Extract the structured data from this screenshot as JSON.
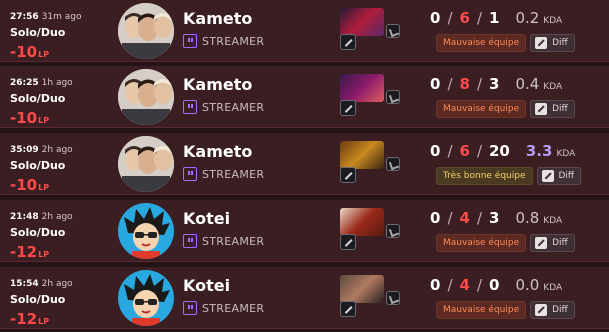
{
  "matches": [
    {
      "time": "27:56",
      "ago": "31m ago",
      "queue": "Solo/Duo",
      "lp": "-10",
      "lp_unit": "LP",
      "player": "Kameto",
      "streamer_label": "STREAMER",
      "avatar": "person",
      "kda": {
        "k": "0",
        "d": "6",
        "a": "1",
        "ratio": "0.2",
        "label": "KDA"
      },
      "tag": {
        "label": "Mauvaise équipe",
        "type": "bad"
      },
      "diff_label": "Diff",
      "champ_colors": [
        "#2a1a3a",
        "#b01c3c",
        "#5a2a6a"
      ]
    },
    {
      "time": "26:25",
      "ago": "1h ago",
      "queue": "Solo/Duo",
      "lp": "-10",
      "lp_unit": "LP",
      "player": "Kameto",
      "streamer_label": "STREAMER",
      "avatar": "person",
      "kda": {
        "k": "0",
        "d": "8",
        "a": "3",
        "ratio": "0.4",
        "label": "KDA"
      },
      "tag": {
        "label": "Mauvaise équipe",
        "type": "bad"
      },
      "diff_label": "Diff",
      "champ_colors": [
        "#3a1a4a",
        "#8a1a6a",
        "#e06060"
      ]
    },
    {
      "time": "35:09",
      "ago": "2h ago",
      "queue": "Solo/Duo",
      "lp": "-10",
      "lp_unit": "LP",
      "player": "Kameto",
      "streamer_label": "STREAMER",
      "avatar": "person",
      "kda": {
        "k": "0",
        "d": "6",
        "a": "20",
        "ratio": "3.3",
        "label": "KDA",
        "highlight": true
      },
      "tag": {
        "label": "Très bonne équipe",
        "type": "good"
      },
      "diff_label": "Diff",
      "champ_colors": [
        "#6a3a10",
        "#c88a20",
        "#3a2410"
      ]
    },
    {
      "time": "21:48",
      "ago": "2h ago",
      "queue": "Solo/Duo",
      "lp": "-12",
      "lp_unit": "LP",
      "player": "Kotei",
      "streamer_label": "STREAMER",
      "avatar": "cartoon",
      "kda": {
        "k": "0",
        "d": "4",
        "a": "3",
        "ratio": "0.8",
        "label": "KDA"
      },
      "tag": {
        "label": "Mauvaise équipe",
        "type": "bad"
      },
      "diff_label": "Diff",
      "champ_colors": [
        "#e8d8c8",
        "#9a2a1a",
        "#5a1a10"
      ]
    },
    {
      "time": "15:54",
      "ago": "2h ago",
      "queue": "Solo/Duo",
      "lp": "-12",
      "lp_unit": "LP",
      "player": "Kotei",
      "streamer_label": "STREAMER",
      "avatar": "cartoon",
      "kda": {
        "k": "0",
        "d": "4",
        "a": "0",
        "ratio": "0.0",
        "label": "KDA"
      },
      "tag": {
        "label": "Mauvaise équipe",
        "type": "bad"
      },
      "diff_label": "Diff",
      "champ_colors": [
        "#5a4a40",
        "#b07a60",
        "#2a2020"
      ]
    }
  ]
}
